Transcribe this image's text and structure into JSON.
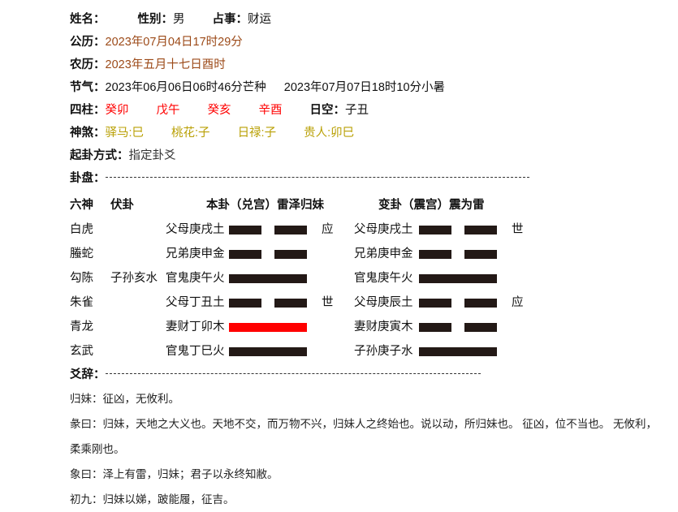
{
  "header": {
    "name_label": "姓名：",
    "name_value": "",
    "gender_label": "性别：",
    "gender_value": "男",
    "topic_label": "占事：",
    "topic_value": "财运",
    "solar_label": "公历：",
    "solar_value": "2023年07月04日17时29分",
    "lunar_label": "农历：",
    "lunar_value": "2023年五月十七日酉时",
    "jieqi_label": "节气：",
    "jieqi_value_1": "2023年06月06日06时46分芒种",
    "jieqi_value_2": "2023年07月07日18时10分小暑",
    "sizhu_label": "四柱：",
    "sizhu_pillars": [
      "癸卯",
      "戊午",
      "癸亥",
      "辛酉"
    ],
    "rikong_label": "日空：",
    "rikong_value": "子丑",
    "shensha_label": "神煞：",
    "shensha_items": [
      "驿马:巳",
      "桃花:子",
      "日禄:子",
      "贵人:卯巳"
    ],
    "qigua_label": "起卦方式：",
    "qigua_value": "指定卦爻",
    "guapan_label": "卦盘："
  },
  "hexagram": {
    "col_liushen": "六神",
    "col_fugua": "伏卦",
    "col_bengua": "本卦（兑宫）雷泽归妹",
    "col_biangua": "变卦（震宫）震为雷",
    "rows": [
      {
        "liushen": "白虎",
        "fugua": "",
        "ben_name": "父母庚戌土",
        "ben_type": "broken",
        "ben_changing": false,
        "ben_mark": "应",
        "bian_name": "父母庚戌土",
        "bian_type": "broken",
        "bian_mark": "世"
      },
      {
        "liushen": "螣蛇",
        "fugua": "",
        "ben_name": "兄弟庚申金",
        "ben_type": "broken",
        "ben_changing": false,
        "ben_mark": "",
        "bian_name": "兄弟庚申金",
        "bian_type": "broken",
        "bian_mark": ""
      },
      {
        "liushen": "勾陈",
        "fugua": "子孙亥水",
        "ben_name": "官鬼庚午火",
        "ben_type": "solid",
        "ben_changing": false,
        "ben_mark": "",
        "bian_name": "官鬼庚午火",
        "bian_type": "solid",
        "bian_mark": ""
      },
      {
        "liushen": "朱雀",
        "fugua": "",
        "ben_name": "父母丁丑土",
        "ben_type": "broken",
        "ben_changing": false,
        "ben_mark": "世",
        "bian_name": "父母庚辰土",
        "bian_type": "broken",
        "bian_mark": "应"
      },
      {
        "liushen": "青龙",
        "fugua": "",
        "ben_name": "妻财丁卯木",
        "ben_type": "solid",
        "ben_changing": true,
        "ben_mark": "",
        "bian_name": "妻财庚寅木",
        "bian_type": "broken",
        "bian_mark": ""
      },
      {
        "liushen": "玄武",
        "fugua": "",
        "ben_name": "官鬼丁巳火",
        "ben_type": "solid",
        "ben_changing": false,
        "ben_mark": "",
        "bian_name": "子孙庚子水",
        "bian_type": "solid",
        "bian_mark": ""
      }
    ]
  },
  "yaoci": {
    "label": "爻辞：",
    "lines": [
      "归妹：征凶，无攸利。",
      "彖曰：归妹，天地之大义也。天地不交，而万物不兴，归妹人之终始也。说以动，所归妹也。 征凶，位不当也。 无攸利，柔乘刚也。",
      "象曰：泽上有雷，归妹；君子以永终知敝。",
      "初九：归妹以娣，跛能履，征吉。"
    ]
  },
  "colors": {
    "brown": "#9C4A18",
    "red": "#FF0000",
    "gold": "#B9A005",
    "line": "#231916"
  }
}
